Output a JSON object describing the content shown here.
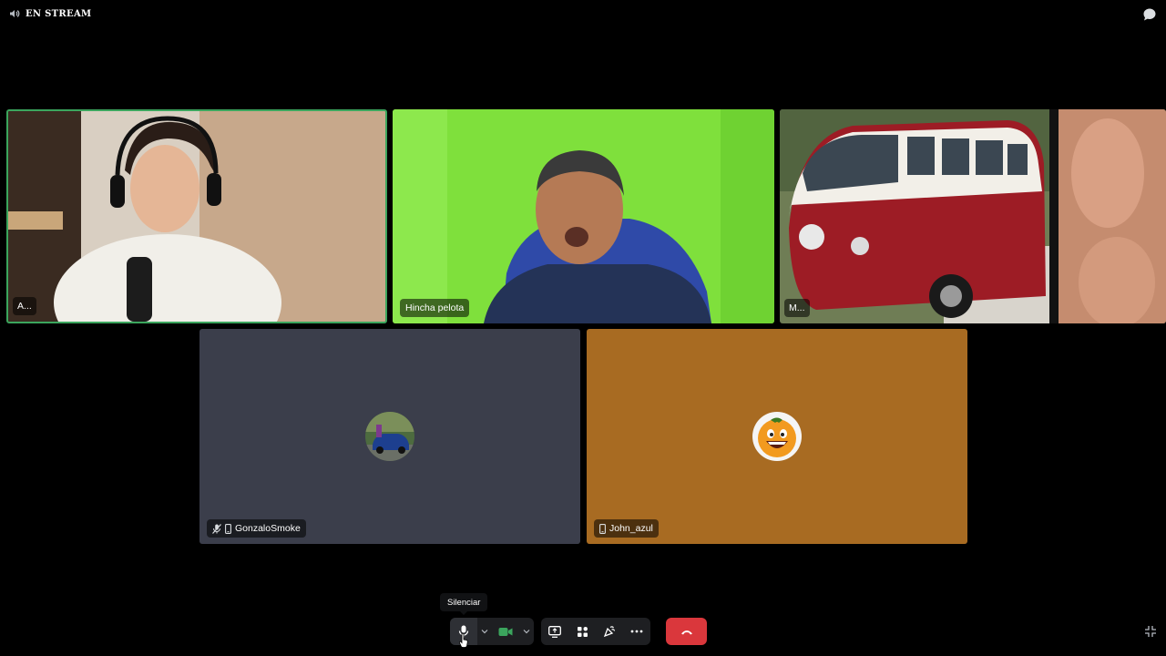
{
  "header": {
    "stream_label": "EN STREAM",
    "speaker_icon": "speaker-icon",
    "chat_icon": "chat-bubble-icon"
  },
  "participants": [
    {
      "name": "A...",
      "speaking": true
    },
    {
      "name": "Hincha pelota",
      "speaking": false
    },
    {
      "name": "M...",
      "speaking": false
    },
    {
      "name": "GonzaloSmoke",
      "muted": true,
      "device": "mobile",
      "avatar": "car-photo-avatar",
      "tile_color": "#3b3e4b"
    },
    {
      "name": "John_azul",
      "muted": false,
      "device": "mobile",
      "avatar": "orange-face-avatar",
      "tile_color": "#a86b22"
    }
  ],
  "controls": {
    "tooltip": "Silenciar",
    "mic_icon": "microphone-icon",
    "camera_icon": "video-camera-icon",
    "screen_share_icon": "screen-share-icon",
    "activities_icon": "activities-icon",
    "soundboard_icon": "soundboard-icon",
    "more_icon": "more-dots-icon",
    "leave_icon": "hang-up-icon",
    "fullscreen_icon": "exit-fullscreen-icon"
  },
  "colors": {
    "speaking_ring": "#3ba55d",
    "leave_button": "#da373c",
    "camera_on": "#3ba55d",
    "toolbar_bg": "#1e1f22"
  }
}
